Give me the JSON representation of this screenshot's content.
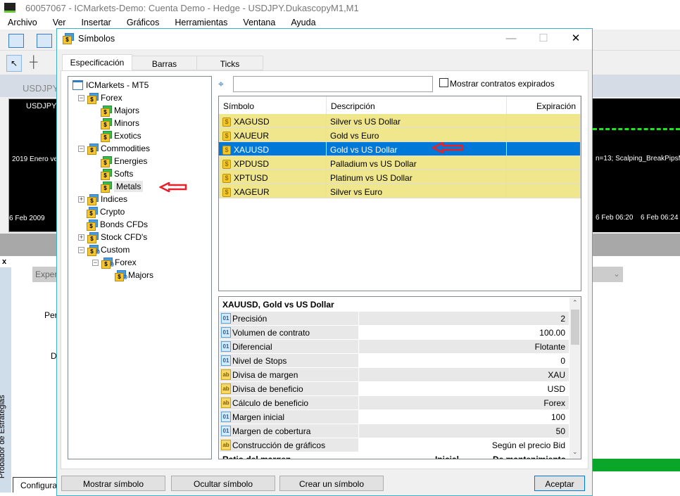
{
  "app": {
    "title": "60057067 - ICMarkets-Demo: Cuenta Demo - Hedge - USDJPY.DukascopyM1,M1",
    "menu": [
      "Archivo",
      "Ver",
      "Insertar",
      "Gráficos",
      "Herramientas",
      "Ventana",
      "Ayuda"
    ],
    "chart_tab": "USDJPY.D",
    "chart_label": "USDJPY.I",
    "chart_text_left": "2019 Enero ve",
    "chart_text_right": "n=13; Scalping_BreakPipsM15",
    "chart_dates": [
      "6 Feb 2009",
      "6 Feb 06:20",
      "6 Feb 06:24"
    ],
    "tester": {
      "side_label": "Probador de Estrategias",
      "expert_label": "Expert",
      "per_label": "Per",
      "d_label": "D",
      "config_tab": "Configura",
      "close": "x"
    }
  },
  "dialog": {
    "title": "Símbolos",
    "minimize": "—",
    "maximize": "☐",
    "close": "✕",
    "tabs": [
      {
        "label": "Especificación",
        "active": true
      },
      {
        "label": "Barras"
      },
      {
        "label": "Ticks"
      }
    ],
    "tree": [
      {
        "label": "ICMarkets - MT5",
        "level": 0,
        "icon": "server"
      },
      {
        "label": "Forex",
        "level": 1,
        "exp": "−"
      },
      {
        "label": "Majors",
        "level": 2
      },
      {
        "label": "Minors",
        "level": 2
      },
      {
        "label": "Exotics",
        "level": 2
      },
      {
        "label": "Commodities",
        "level": 1,
        "exp": "−"
      },
      {
        "label": "Energies",
        "level": 2
      },
      {
        "label": "Softs",
        "level": 2
      },
      {
        "label": "Metals",
        "level": 2,
        "selected": true
      },
      {
        "label": "Indices",
        "level": 1,
        "exp": "+"
      },
      {
        "label": "Crypto",
        "level": 1
      },
      {
        "label": "Bonds CFDs",
        "level": 1
      },
      {
        "label": "Stock CFD's",
        "level": 1,
        "exp": "+"
      },
      {
        "label": "Custom",
        "level": 1,
        "exp": "−",
        "custom": true
      },
      {
        "label": "Forex",
        "level": 2,
        "exp": "−",
        "custom": true
      },
      {
        "label": "Majors",
        "level": 3,
        "custom": true
      }
    ],
    "search": {
      "value": "",
      "placeholder": ""
    },
    "show_expired": {
      "label": "Mostrar contratos expirados",
      "checked": false
    },
    "table": {
      "headers": [
        "Símbolo",
        "Descripción",
        "Expiración"
      ],
      "rows": [
        [
          "XAGUSD",
          "Silver vs US Dollar",
          ""
        ],
        [
          "XAUEUR",
          "Gold vs Euro",
          ""
        ],
        [
          "XAUUSD",
          "Gold vs US Dollar",
          ""
        ],
        [
          "XPDUSD",
          "Palladium vs US Dollar",
          ""
        ],
        [
          "XPTUSD",
          "Platinum vs US Dollar",
          ""
        ],
        [
          "XAGEUR",
          "Silver vs Euro",
          ""
        ]
      ],
      "selected_index": 2
    },
    "details": {
      "title": "XAUUSD, Gold vs US Dollar",
      "rows": [
        [
          "01",
          "Precisión",
          "2"
        ],
        [
          "01",
          "Volumen de contrato",
          "100.00"
        ],
        [
          "01",
          "Diferencial",
          "Flotante"
        ],
        [
          "01",
          "Nivel de Stops",
          "0"
        ],
        [
          "ab",
          "Divisa de margen",
          "XAU"
        ],
        [
          "ab",
          "Divisa de beneficio",
          "USD"
        ],
        [
          "ab",
          "Cálculo de beneficio",
          "Forex"
        ],
        [
          "01",
          "Margen inicial",
          "100"
        ],
        [
          "01",
          "Margen de cobertura",
          "50"
        ],
        [
          "ab",
          "Construcción de gráficos",
          "Según el precio Bid"
        ]
      ],
      "partial_header": [
        "Ratio del margen",
        "Inicial",
        "De mantenimiento"
      ]
    },
    "buttons": {
      "show": "Mostrar símbolo",
      "hide": "Ocultar símbolo",
      "create": "Crear un símbolo",
      "ok": "Aceptar"
    },
    "colors": {
      "row_highlight": "#f0e68c",
      "selection": "#0078d7",
      "annotation_arrow": "#e8202a"
    }
  }
}
